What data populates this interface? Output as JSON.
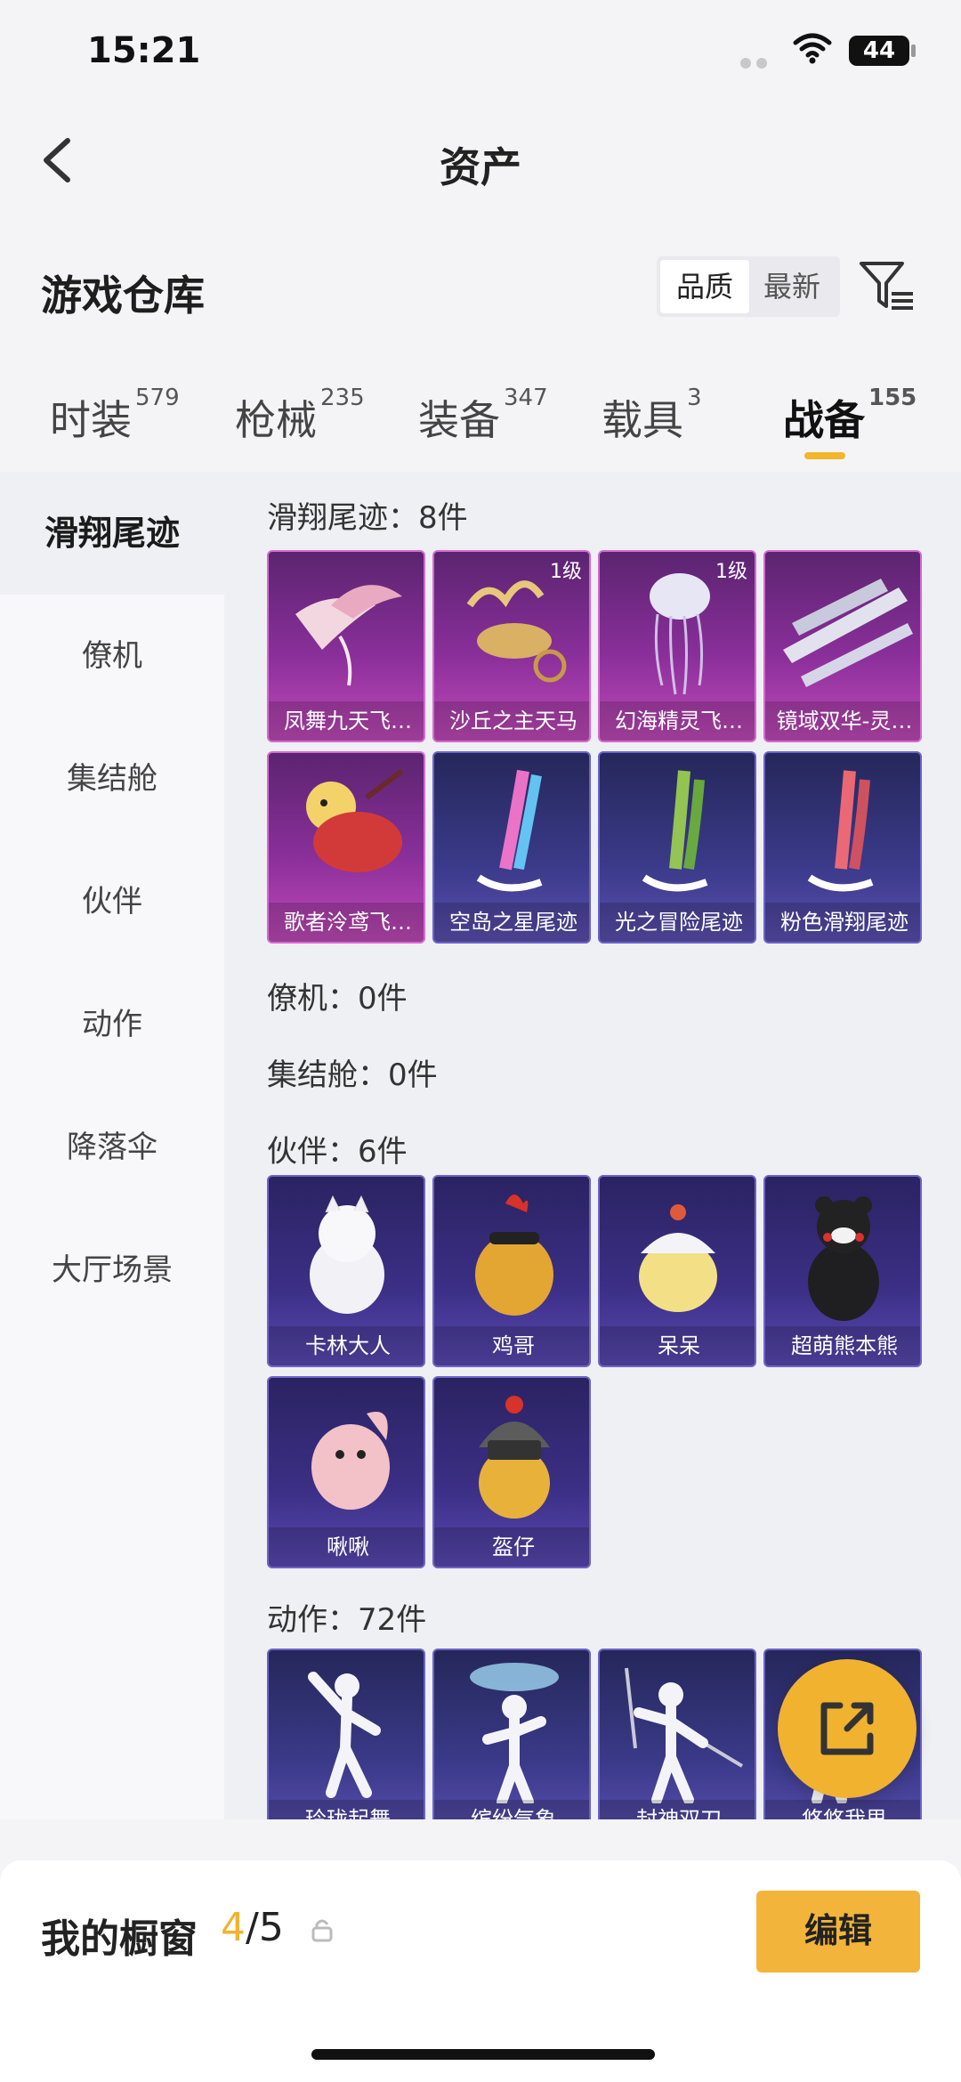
{
  "status_bar": {
    "time": "15:21",
    "battery": "44"
  },
  "nav": {
    "title": "资产"
  },
  "section": {
    "title": "游戏仓库",
    "sort_options": [
      "品质",
      "最新"
    ]
  },
  "tabs": [
    {
      "label": "时装",
      "count": "579"
    },
    {
      "label": "枪械",
      "count": "235"
    },
    {
      "label": "装备",
      "count": "347"
    },
    {
      "label": "载具",
      "count": "3"
    },
    {
      "label": "战备",
      "count": "155"
    }
  ],
  "sidebar": [
    "滑翔尾迹",
    "僚机",
    "集结舱",
    "伙伴",
    "动作",
    "降落伞",
    "大厅场景"
  ],
  "groups": {
    "glide": {
      "title": "滑翔尾迹：8件",
      "items": [
        {
          "name": "凤舞九天飞…",
          "level": ""
        },
        {
          "name": "沙丘之主天马",
          "level": "1级"
        },
        {
          "name": "幻海精灵飞…",
          "level": "1级"
        },
        {
          "name": "镜域双华-灵…",
          "level": ""
        },
        {
          "name": "歌者泠鸢飞…",
          "level": ""
        },
        {
          "name": "空岛之星尾迹",
          "level": ""
        },
        {
          "name": "光之冒险尾迹",
          "level": ""
        },
        {
          "name": "粉色滑翔尾迹",
          "level": ""
        }
      ]
    },
    "wingman": {
      "title": "僚机：0件"
    },
    "pod": {
      "title": "集结舱：0件"
    },
    "partner": {
      "title": "伙伴：6件",
      "items": [
        {
          "name": "卡林大人"
        },
        {
          "name": "鸡哥"
        },
        {
          "name": "呆呆"
        },
        {
          "name": "超萌熊本熊"
        },
        {
          "name": "啾啾"
        },
        {
          "name": "盔仔"
        }
      ]
    },
    "emote": {
      "title": "动作：72件",
      "items": [
        {
          "name": "玲珑起舞"
        },
        {
          "name": "缤纷气象"
        },
        {
          "name": "封神双刀"
        },
        {
          "name": "悠悠我思"
        }
      ]
    }
  },
  "showcase": {
    "label": "我的橱窗",
    "current": "4",
    "total": "/5",
    "edit": "编辑"
  },
  "colors": {
    "accent": "#f2b43a",
    "legend_card": "#8a2f9a",
    "epic_card": "#3b3a8a"
  }
}
